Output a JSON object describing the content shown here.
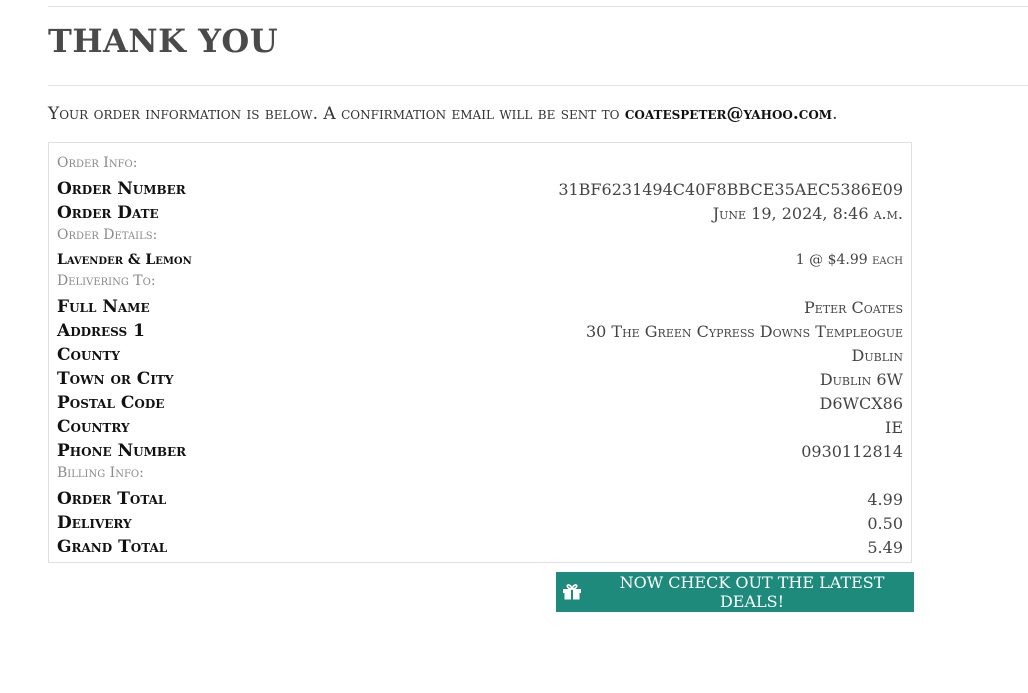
{
  "page": {
    "title": "THANK YOU",
    "intro_text": "Your order information is below. A confirmation email will be sent to ",
    "email": "coatespeter@yahoo.com",
    "intro_end": "."
  },
  "order_info": {
    "label": "Order Info:",
    "rows": [
      {
        "key": "Order Number",
        "value": "31BF6231494C40F8BBCE35AEC5386E09"
      },
      {
        "key": "Order Date",
        "value": "June 19, 2024, 8:46 a.m."
      }
    ]
  },
  "order_details": {
    "label": "Order Details:",
    "items": [
      {
        "key": "Lavender & Lemon",
        "value": "1 @ $4.99 each"
      }
    ]
  },
  "delivering_to": {
    "label": "Delivering To:",
    "rows": [
      {
        "key": "Full Name",
        "value": "Peter Coates"
      },
      {
        "key": "Address 1",
        "value": "30 The Green Cypress Downs Templeogue"
      },
      {
        "key": "County",
        "value": "Dublin"
      },
      {
        "key": "Town or City",
        "value": "Dublin 6W"
      },
      {
        "key": "Postal Code",
        "value": "D6WCX86"
      },
      {
        "key": "Country",
        "value": "IE"
      },
      {
        "key": "Phone Number",
        "value": "0930112814"
      }
    ]
  },
  "billing_info": {
    "label": "Billing Info:",
    "rows": [
      {
        "key": "Order Total",
        "value": "4.99"
      },
      {
        "key": "Delivery",
        "value": "0.50"
      },
      {
        "key": "Grand Total",
        "value": "5.49"
      }
    ]
  },
  "deals_button": {
    "label": "NOW CHECK OUT THE LATEST DEALS!",
    "icon": "gift-icon"
  },
  "colors": {
    "accent": "#1e8a7c"
  }
}
